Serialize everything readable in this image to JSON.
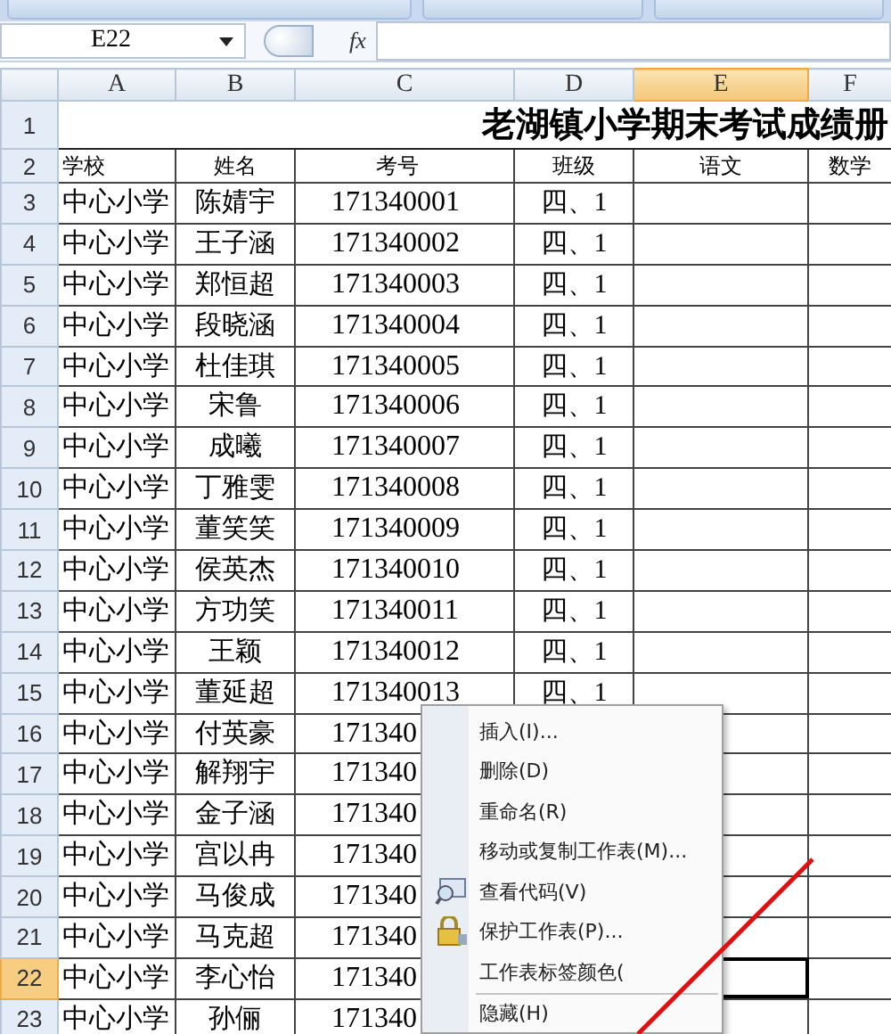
{
  "formula_bar": {
    "name_box": "E22",
    "function_label": "fx"
  },
  "columns": [
    {
      "label": "A",
      "selected": false
    },
    {
      "label": "B",
      "selected": false
    },
    {
      "label": "C",
      "selected": false
    },
    {
      "label": "D",
      "selected": false
    },
    {
      "label": "E",
      "selected": true
    },
    {
      "label": "F",
      "selected": false
    }
  ],
  "title_row": {
    "row": "1",
    "text": "老湖镇小学期末考试成绩册"
  },
  "rows": [
    {
      "row": "2",
      "selected": false,
      "cells": [
        "学校",
        "姓名",
        "考号",
        "班级",
        "语文",
        "数学"
      ]
    },
    {
      "row": "3",
      "selected": false,
      "cells": [
        "中心小学",
        "陈婧宇",
        "171340001",
        "四、1",
        "",
        ""
      ]
    },
    {
      "row": "4",
      "selected": false,
      "cells": [
        "中心小学",
        "王子涵",
        "171340002",
        "四、1",
        "",
        ""
      ]
    },
    {
      "row": "5",
      "selected": false,
      "cells": [
        "中心小学",
        "郑恒超",
        "171340003",
        "四、1",
        "",
        ""
      ]
    },
    {
      "row": "6",
      "selected": false,
      "cells": [
        "中心小学",
        "段晓涵",
        "171340004",
        "四、1",
        "",
        ""
      ]
    },
    {
      "row": "7",
      "selected": false,
      "cells": [
        "中心小学",
        "杜佳琪",
        "171340005",
        "四、1",
        "",
        ""
      ]
    },
    {
      "row": "8",
      "selected": false,
      "cells": [
        "中心小学",
        "宋鲁",
        "171340006",
        "四、1",
        "",
        ""
      ]
    },
    {
      "row": "9",
      "selected": false,
      "cells": [
        "中心小学",
        "成曦",
        "171340007",
        "四、1",
        "",
        ""
      ]
    },
    {
      "row": "10",
      "selected": false,
      "cells": [
        "中心小学",
        "丁雅雯",
        "171340008",
        "四、1",
        "",
        ""
      ]
    },
    {
      "row": "11",
      "selected": false,
      "cells": [
        "中心小学",
        "董笑笑",
        "171340009",
        "四、1",
        "",
        ""
      ]
    },
    {
      "row": "12",
      "selected": false,
      "cells": [
        "中心小学",
        "侯英杰",
        "171340010",
        "四、1",
        "",
        ""
      ]
    },
    {
      "row": "13",
      "selected": false,
      "cells": [
        "中心小学",
        "方功笑",
        "171340011",
        "四、1",
        "",
        ""
      ]
    },
    {
      "row": "14",
      "selected": false,
      "cells": [
        "中心小学",
        "王颖",
        "171340012",
        "四、1",
        "",
        ""
      ]
    },
    {
      "row": "15",
      "selected": false,
      "cells": [
        "中心小学",
        "董延超",
        "171340013",
        "四、1",
        "",
        ""
      ]
    },
    {
      "row": "16",
      "selected": false,
      "cells": [
        "中心小学",
        "付英豪",
        "171340",
        "",
        "",
        ""
      ]
    },
    {
      "row": "17",
      "selected": false,
      "cells": [
        "中心小学",
        "解翔宇",
        "171340",
        "",
        "",
        ""
      ]
    },
    {
      "row": "18",
      "selected": false,
      "cells": [
        "中心小学",
        "金子涵",
        "171340",
        "",
        "",
        ""
      ]
    },
    {
      "row": "19",
      "selected": false,
      "cells": [
        "中心小学",
        "宫以冉",
        "171340",
        "",
        "",
        ""
      ]
    },
    {
      "row": "20",
      "selected": false,
      "cells": [
        "中心小学",
        "马俊成",
        "171340",
        "",
        "",
        ""
      ]
    },
    {
      "row": "21",
      "selected": false,
      "cells": [
        "中心小学",
        "马克超",
        "171340",
        "",
        "",
        ""
      ]
    },
    {
      "row": "22",
      "selected": true,
      "cells": [
        "中心小学",
        "李心怡",
        "171340",
        "",
        "",
        ""
      ]
    },
    {
      "row": "23",
      "selected": false,
      "cells": [
        "中心小学",
        "孙俪",
        "171340",
        "",
        "",
        ""
      ]
    }
  ],
  "context_menu": [
    {
      "label": "插入(I)...",
      "kind": "plain",
      "separator_before": false
    },
    {
      "label": "删除(D)",
      "kind": "plain",
      "separator_before": false
    },
    {
      "label": "重命名(R)",
      "kind": "plain",
      "separator_before": false
    },
    {
      "label": "移动或复制工作表(M)...",
      "kind": "plain",
      "separator_before": false
    },
    {
      "label": "查看代码(V)",
      "kind": "code",
      "separator_before": false
    },
    {
      "label": "保护工作表(P)...",
      "kind": "lock",
      "separator_before": false
    },
    {
      "label": "工作表标签颜色(",
      "kind": "plain",
      "separator_before": false
    },
    {
      "label": "隐藏(H)",
      "kind": "plain",
      "separator_before": true
    }
  ]
}
